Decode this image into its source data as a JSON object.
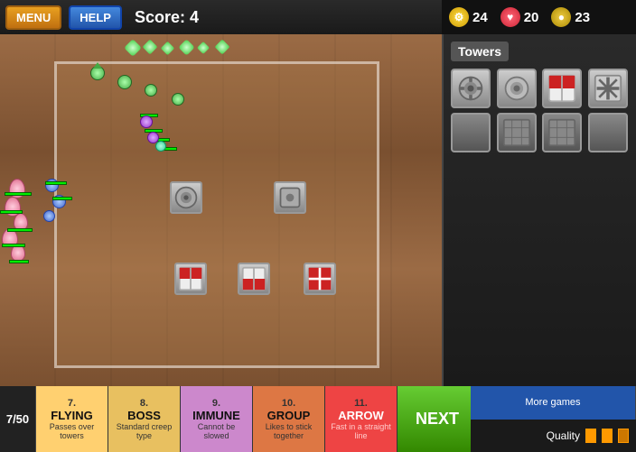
{
  "header": {
    "menu_label": "MENU",
    "help_label": "HELP",
    "score_label": "Score: 4"
  },
  "resources": {
    "gold_value": "24",
    "heart_value": "20",
    "coin_value": "23"
  },
  "sidebar": {
    "towers_label": "Towers"
  },
  "waves": [
    {
      "num": "7.",
      "title": "FLYING",
      "desc": "Passes over towers"
    },
    {
      "num": "8.",
      "title": "BOSS",
      "desc": "Standard creep type"
    },
    {
      "num": "9.",
      "title": "IMMUNE",
      "desc": "Cannot be slowed"
    },
    {
      "num": "10.",
      "title": "GROUP",
      "desc": "Likes to stick together"
    },
    {
      "num": "11.",
      "title": "ARROW",
      "desc": "Fast in a straight line"
    }
  ],
  "bottom": {
    "wave_counter": "7/50",
    "next_label": "NEXT",
    "more_games_label": "More games",
    "quality_label": "Quality"
  }
}
